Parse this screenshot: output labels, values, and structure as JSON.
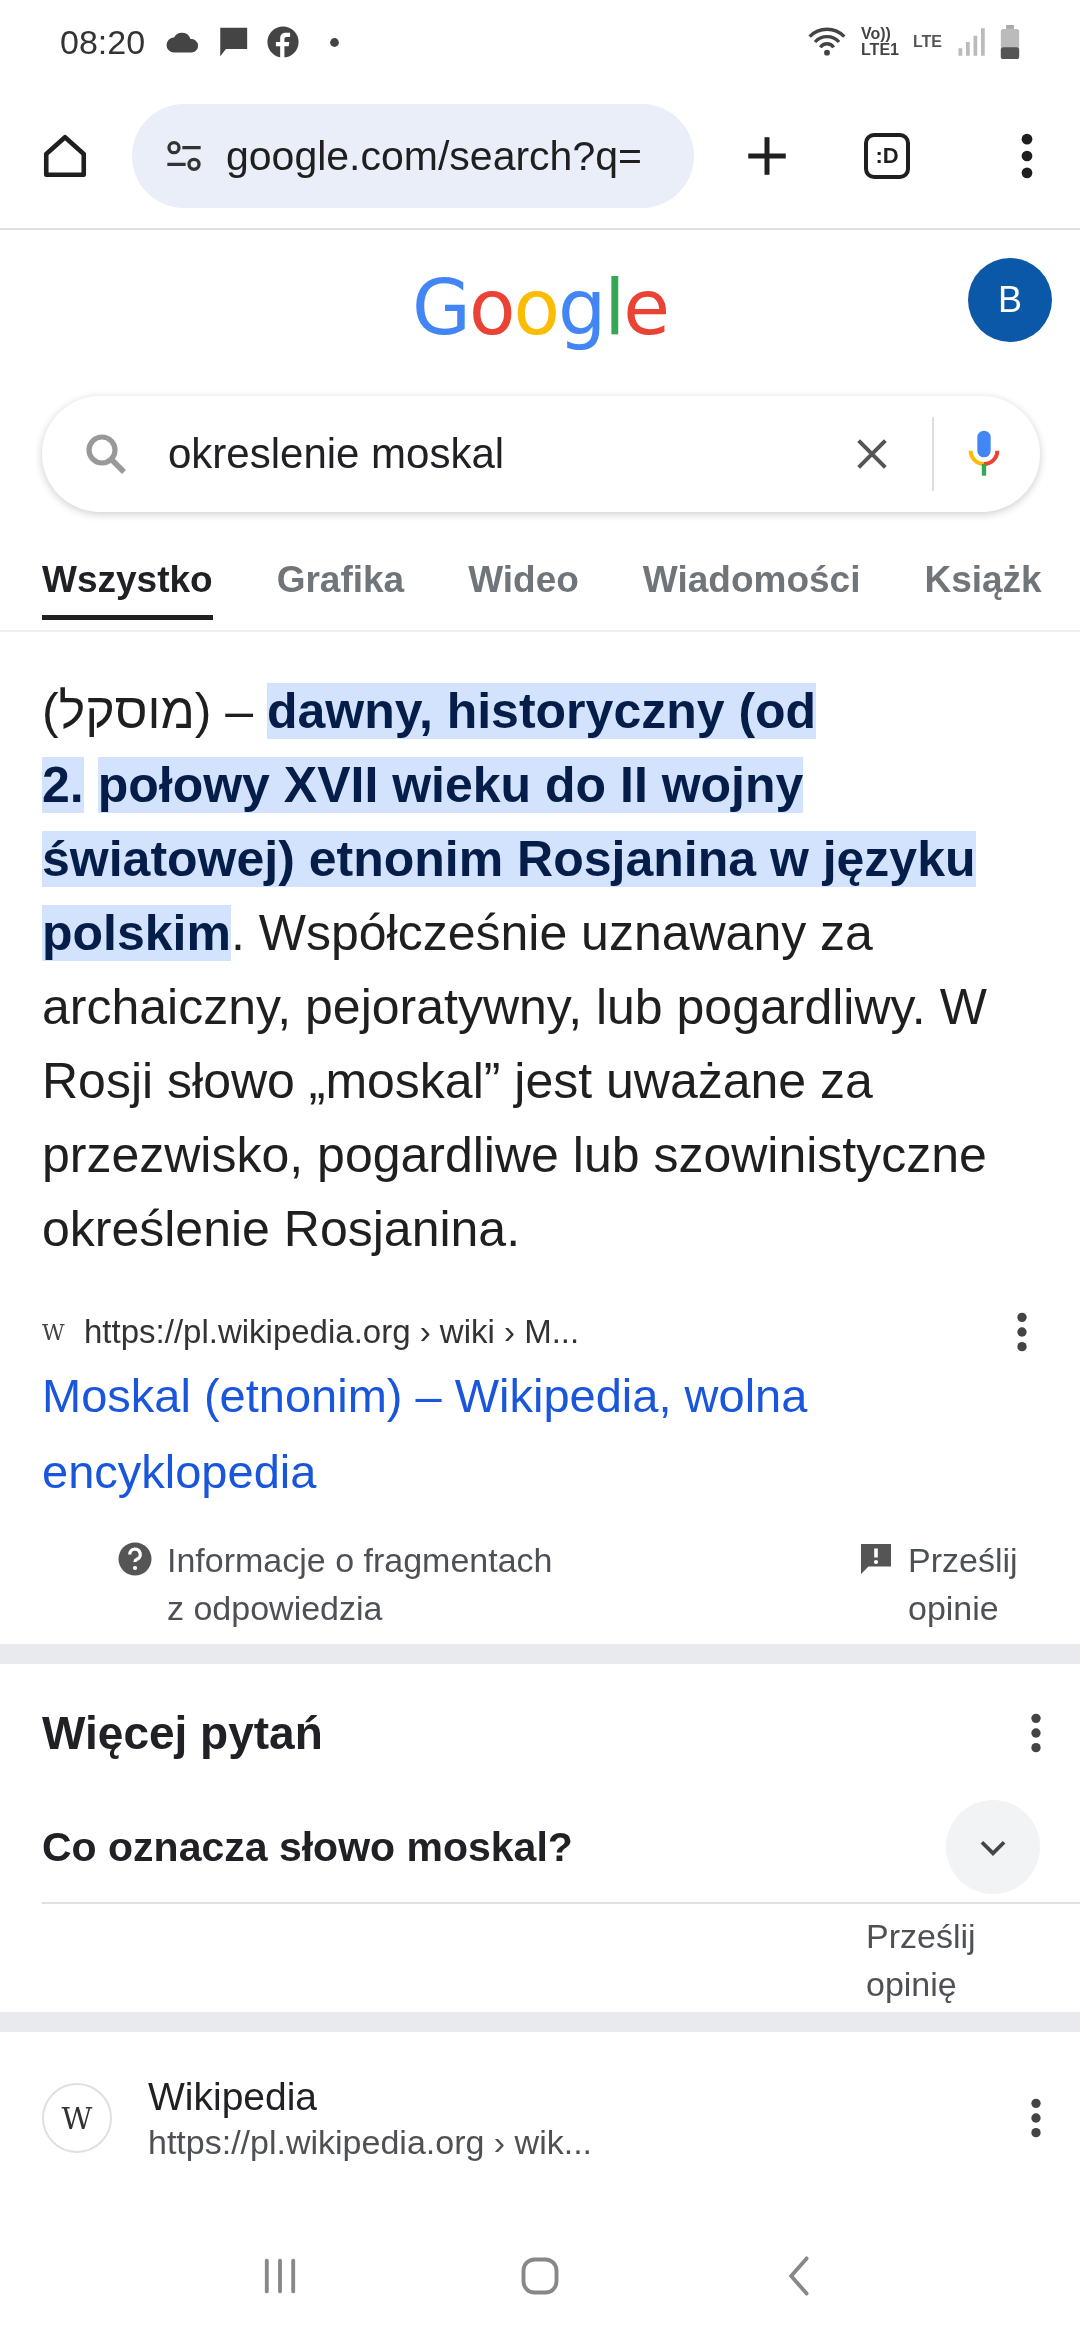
{
  "status_bar": {
    "time": "08:20",
    "network_labels": [
      "Vo))",
      "LTE1",
      "LTE"
    ]
  },
  "browser": {
    "url": "google.com/search?q=",
    "tab_badge": ":D"
  },
  "header": {
    "logo": "Google",
    "avatar": "B"
  },
  "search": {
    "query": "okreslenie moskal"
  },
  "tabs": [
    {
      "label": "Wszystko",
      "selected": true
    },
    {
      "label": "Grafika",
      "selected": false
    },
    {
      "label": "Wideo",
      "selected": false
    },
    {
      "label": "Wiadomości",
      "selected": false
    },
    {
      "label": "Książk",
      "selected": false
    }
  ],
  "answer": {
    "segments": [
      {
        "text": "(מוסקל) – ",
        "highlighted": false
      },
      {
        "text": "dawny, historyczny (od 2.",
        "highlighted": true
      },
      {
        "text": "połowy XVII wieku do II wojny światowej) etnonim Rosjanina w języku polskim",
        "highlighted": true
      },
      {
        "text": ". Współcześnie uznawany za archaiczny, pejoratywny, lub pogardliwy. W Rosji słowo „moskal” jest uważane za przezwisko, pogardliwe lub szowinistyczne określenie Rosjanina.",
        "highlighted": false
      }
    ],
    "source_favicon": "W",
    "source_url": "https://pl.wikipedia.org › wiki › M...",
    "source_title": "Moskal (etnonim) – Wikipedia, wolna encyklopedia",
    "info": "Informacje o fragmentach z odpowiedzia",
    "feedback": "Prześlij opinie"
  },
  "more_questions": {
    "title": "Więcej pytań",
    "questions": [
      {
        "text": "Co oznacza słowo moskal?",
        "expanded": false
      }
    ],
    "feedback": "Prześlij opinię"
  },
  "result": {
    "favicon": "W",
    "site": "Wikipedia",
    "url": "https://pl.wikipedia.org › wik..."
  }
}
